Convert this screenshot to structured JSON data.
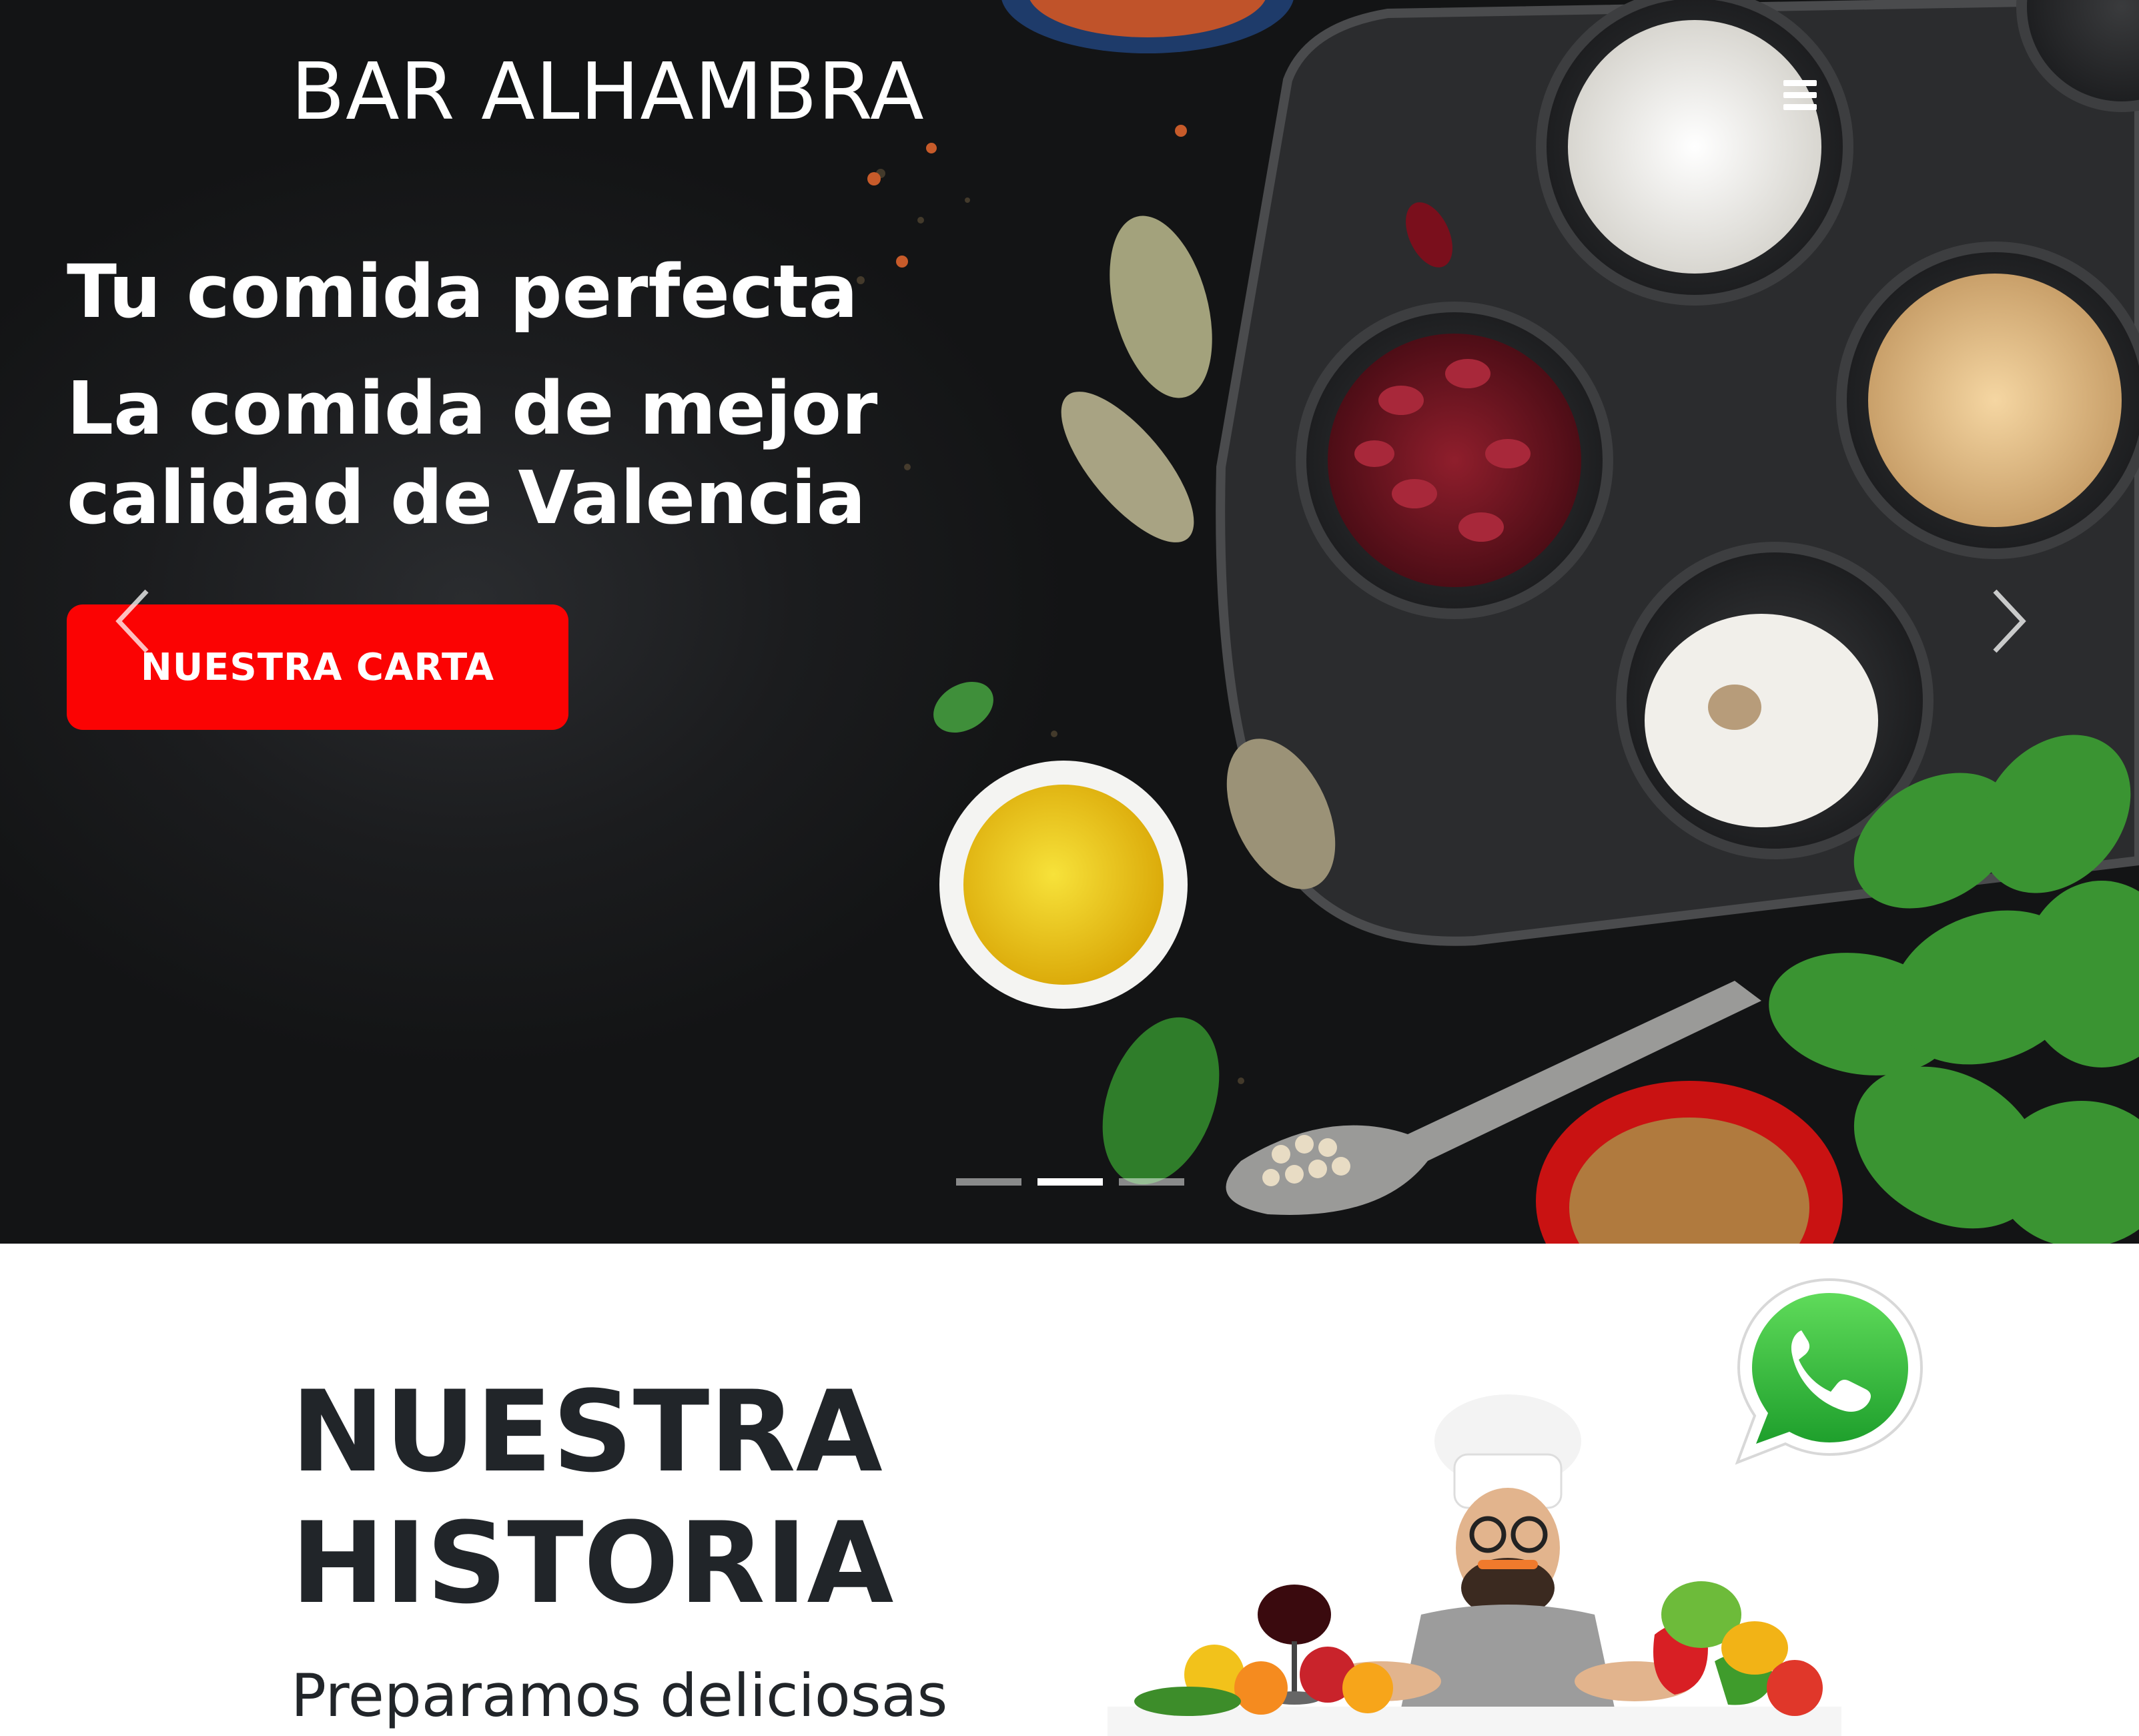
{
  "header": {
    "brand": "BAR ALHAMBRA",
    "menu_icon": "hamburger-menu-icon"
  },
  "hero": {
    "line1": "Tu comida perfecta",
    "line2": "La comida de mejor calidad de Valencia",
    "cta_label": "NUESTRA CARTA",
    "prev_icon": "chevron-left-icon",
    "next_icon": "chevron-right-icon",
    "slides_total": 3,
    "active_slide": 2,
    "background_image": "food-ingredients-on-dark-table",
    "accent_color": "#fb0303"
  },
  "story": {
    "title": "NUESTRA HISTORIA",
    "subtitle": "Preparamos deliciosas",
    "image": "chef-with-vegetables-illustration"
  },
  "floating": {
    "whatsapp_icon": "whatsapp-icon",
    "whatsapp_color": "#25d366"
  }
}
